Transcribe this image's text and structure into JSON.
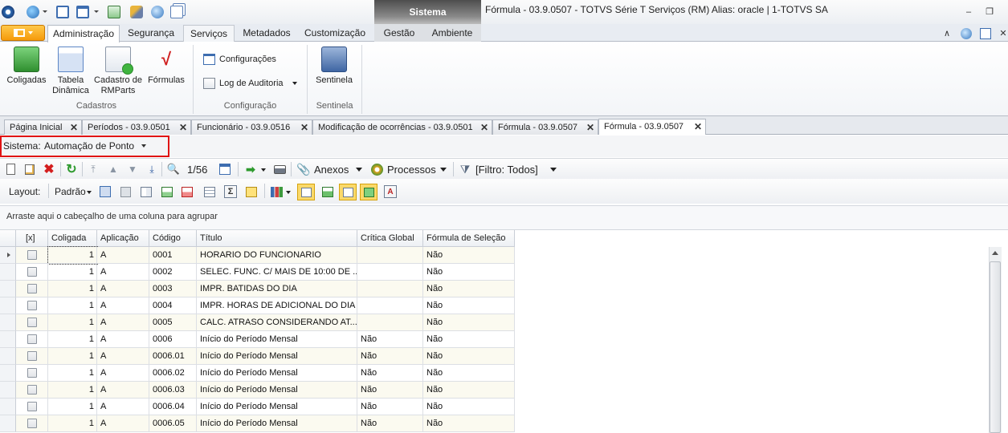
{
  "window": {
    "title": "Fórmula - 03.9.0507 - TOTVS Série T Serviços (RM) Alias: oracle | 1-TOTVS SA",
    "context_tab": "Sistema",
    "controls": [
      "minimize-icon",
      "restore-icon",
      "close-icon"
    ]
  },
  "ribbon": {
    "tabs": [
      "Administração",
      "Segurança",
      "Serviços",
      "Metadados",
      "Customização",
      "Gestão",
      "Ambiente"
    ],
    "active_tab": "Administração",
    "groups": {
      "cadastros": {
        "title": "Cadastros",
        "buttons": [
          {
            "label": "Coligadas",
            "icon": "coligadas-icon",
            "color": "#3c9c3c"
          },
          {
            "label": "Tabela Dinâmica",
            "icon": "tabela-dinamica-icon",
            "color": "#5c86c6"
          },
          {
            "label": "Cadastro de RMParts",
            "icon": "rmparts-icon",
            "color": "#4aa64a"
          },
          {
            "label": "Fórmulas",
            "icon": "formulas-icon",
            "color": "#d02020"
          }
        ]
      },
      "configuracao": {
        "title": "Configuração",
        "buttons": [
          {
            "label": "Configurações",
            "icon": "configuracoes-icon"
          },
          {
            "label": "Log de Auditoria",
            "icon": "log-auditoria-icon"
          }
        ]
      },
      "sentinela": {
        "title": "Sentinela",
        "buttons": [
          {
            "label": "Sentinela",
            "icon": "sentinela-icon"
          }
        ]
      }
    }
  },
  "doc_tabs": [
    {
      "label": "Página Inicial"
    },
    {
      "label": "Períodos - 03.9.0501"
    },
    {
      "label": "Funcionário - 03.9.0516"
    },
    {
      "label": "Modificação de ocorrências - 03.9.0501"
    },
    {
      "label": "Fórmula - 03.9.0507"
    },
    {
      "label": "Fórmula - 03.9.0507",
      "active": true
    }
  ],
  "sistema": {
    "label": "Sistema:",
    "value": "Automação de Ponto",
    "highlight_color": "#e01414"
  },
  "toolbar": {
    "record_position": "1/56",
    "anexos": "Anexos",
    "processos": "Processos",
    "filtro": "[Filtro: Todos]"
  },
  "layout_bar": {
    "label": "Layout:",
    "preset": "Padrão"
  },
  "grid": {
    "group_hint": "Arraste aqui o cabeçalho de uma coluna para agrupar",
    "columns": [
      "[x]",
      "Coligada",
      "Aplicação",
      "Código",
      "Título",
      "Crítica Global",
      "Fórmula de Seleção"
    ],
    "rows": [
      {
        "coligada": "1",
        "aplicacao": "A",
        "codigo": "0001",
        "titulo": "HORARIO DO FUNCIONARIO",
        "critica": "",
        "selecao": "Não"
      },
      {
        "coligada": "1",
        "aplicacao": "A",
        "codigo": "0002",
        "titulo": "SELEC. FUNC. C/ MAIS DE 10:00 DE ...",
        "critica": "",
        "selecao": "Não"
      },
      {
        "coligada": "1",
        "aplicacao": "A",
        "codigo": "0003",
        "titulo": "IMPR. BATIDAS DO DIA",
        "critica": "",
        "selecao": "Não"
      },
      {
        "coligada": "1",
        "aplicacao": "A",
        "codigo": "0004",
        "titulo": "IMPR. HORAS DE ADICIONAL  DO DIA",
        "critica": "",
        "selecao": "Não"
      },
      {
        "coligada": "1",
        "aplicacao": "A",
        "codigo": "0005",
        "titulo": "CALC. ATRASO CONSIDERANDO AT...",
        "critica": "",
        "selecao": "Não"
      },
      {
        "coligada": "1",
        "aplicacao": "A",
        "codigo": "0006",
        "titulo": "Início do Período Mensal",
        "critica": "Não",
        "selecao": "Não"
      },
      {
        "coligada": "1",
        "aplicacao": "A",
        "codigo": "0006.01",
        "titulo": "Início do Período Mensal",
        "critica": "Não",
        "selecao": "Não"
      },
      {
        "coligada": "1",
        "aplicacao": "A",
        "codigo": "0006.02",
        "titulo": "Início do Período Mensal",
        "critica": "Não",
        "selecao": "Não"
      },
      {
        "coligada": "1",
        "aplicacao": "A",
        "codigo": "0006.03",
        "titulo": "Início do Período Mensal",
        "critica": "Não",
        "selecao": "Não"
      },
      {
        "coligada": "1",
        "aplicacao": "A",
        "codigo": "0006.04",
        "titulo": "Início do Período Mensal",
        "critica": "Não",
        "selecao": "Não"
      },
      {
        "coligada": "1",
        "aplicacao": "A",
        "codigo": "0006.05",
        "titulo": "Início do Período Mensal",
        "critica": "Não",
        "selecao": "Não"
      }
    ]
  }
}
